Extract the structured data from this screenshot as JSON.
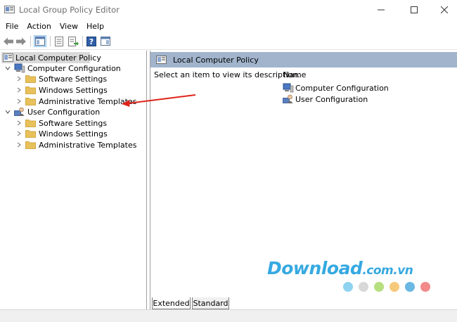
{
  "window": {
    "title": "Local Group Policy Editor"
  },
  "menu": [
    "File",
    "Action",
    "View",
    "Help"
  ],
  "toolbar": {
    "icons": [
      "back-arrow-icon",
      "forward-arrow-icon",
      "show-hide-tree-icon",
      "properties-icon",
      "export-list-icon",
      "help-icon",
      "show-hide-action-pane-icon"
    ]
  },
  "tree": {
    "root": "Local Computer Policy",
    "computer_configuration": {
      "label": "Computer Configuration",
      "children": [
        "Software Settings",
        "Windows Settings",
        "Administrative Templates"
      ]
    },
    "user_configuration": {
      "label": "User Configuration",
      "children": [
        "Software Settings",
        "Windows Settings",
        "Administrative Templates"
      ]
    }
  },
  "right_pane": {
    "header_title": "Local Computer Policy",
    "description": "Select an item to view its description.",
    "column_name": "Name",
    "items": [
      "Computer Configuration",
      "User Configuration"
    ]
  },
  "tabs": [
    "Extended",
    "Standard"
  ],
  "watermark": {
    "brand": "Download",
    "domain": ".com.vn",
    "dot_colors": [
      "#8fd3f0",
      "#d8d8d8",
      "#b6e07f",
      "#f6c97a",
      "#6bb8e4",
      "#f2898a"
    ]
  },
  "colors": {
    "header_band": "#a2b4cc",
    "selection": "#d9d9d9",
    "annotation_arrow": "#e0231a",
    "folder": "#e8c15a"
  }
}
